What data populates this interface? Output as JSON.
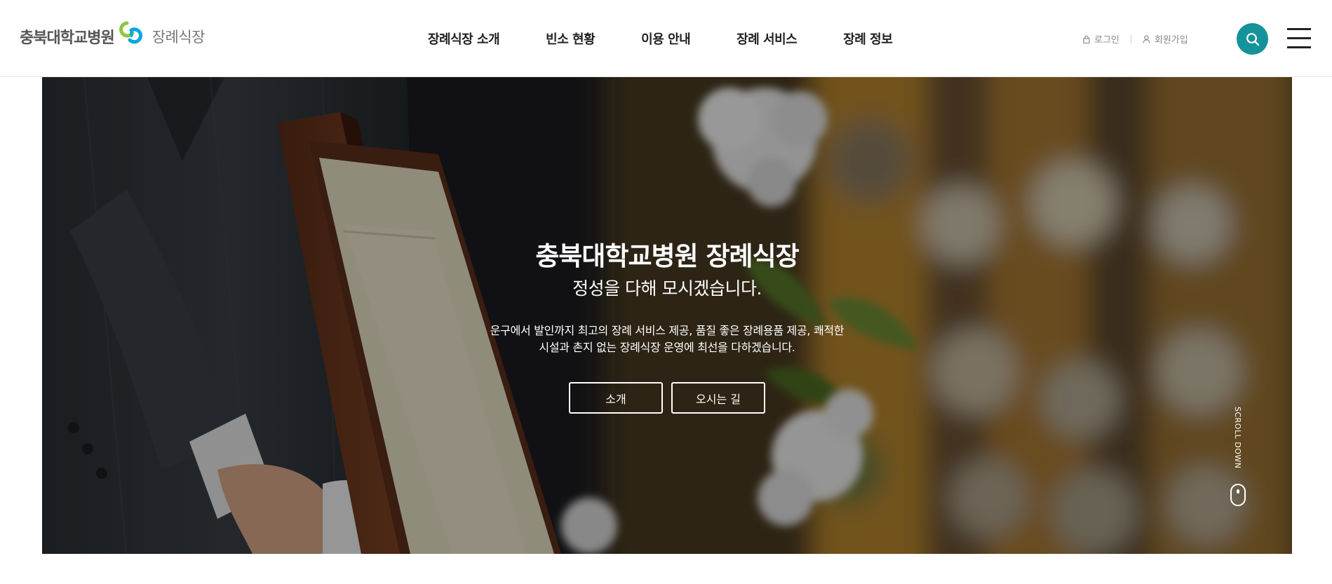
{
  "header": {
    "logo": {
      "hospital_name": "충북대학교병원",
      "sub_name": "장례식장",
      "brand_colors": [
        "#8dc63f",
        "#00a7e1"
      ]
    },
    "nav": [
      {
        "label": "장례식장 소개"
      },
      {
        "label": "빈소 현황"
      },
      {
        "label": "이용 안내"
      },
      {
        "label": "장례 서비스"
      },
      {
        "label": "장례 정보"
      }
    ],
    "util": {
      "login": {
        "label": "로그인",
        "icon": "lock-icon"
      },
      "signup": {
        "label": "회원가입",
        "icon": "user-icon"
      }
    },
    "search_icon": "search-icon",
    "menu_icon": "hamburger-menu-icon",
    "accent_color": "#15939a"
  },
  "hero": {
    "title": "충북대학교병원 장례식장",
    "subtitle": "정성을 다해 모시겠습니다.",
    "description_line1": "운구에서 발인까지 최고의 장례 서비스 제공, 품질 좋은 장례용품 제공, 쾌적한",
    "description_line2": "시설과 촌지 없는 장례식장 운영에 최선을 다하겠습니다.",
    "buttons": [
      {
        "label": "소개"
      },
      {
        "label": "오시는 길"
      }
    ],
    "scroll_label": "SCROLL DOWN",
    "scroll_icon": "mouse-icon"
  }
}
